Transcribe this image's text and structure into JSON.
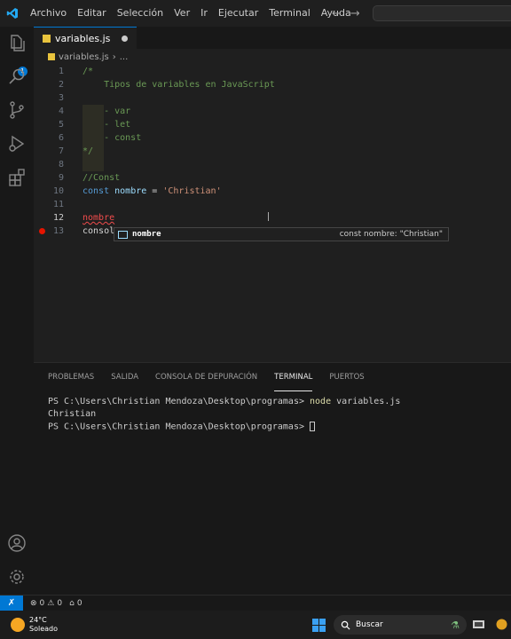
{
  "menu": [
    "Archivo",
    "Editar",
    "Selección",
    "Ver",
    "Ir",
    "Ejecutar",
    "Terminal",
    "Ayuda"
  ],
  "activity_badge": "1",
  "tab": {
    "label": "variables.js"
  },
  "breadcrumb": {
    "file": "variables.js",
    "more": "..."
  },
  "code_lines": [
    {
      "n": "1",
      "text": "/*"
    },
    {
      "n": "2",
      "text": "    Tipos de variables en JavaScript"
    },
    {
      "n": "3",
      "text": ""
    },
    {
      "n": "4",
      "text": "    - var"
    },
    {
      "n": "5",
      "text": "    - let"
    },
    {
      "n": "6",
      "text": "    - const"
    },
    {
      "n": "7",
      "text": "*/"
    },
    {
      "n": "8",
      "text": ""
    },
    {
      "n": "9",
      "text": "//Const"
    },
    {
      "n": "10",
      "kw": "const",
      "var": "nombre",
      "op": "=",
      "str": "'Christian'"
    },
    {
      "n": "11",
      "text": ""
    },
    {
      "n": "12",
      "err": "nombre"
    },
    {
      "n": "13",
      "text": "consol"
    }
  ],
  "suggest": {
    "icon": "[@]",
    "label": "nombre",
    "detail": "const nombre: \"Christian\""
  },
  "panel_tabs": [
    "PROBLEMAS",
    "SALIDA",
    "CONSOLA DE DEPURACIÓN",
    "TERMINAL",
    "PUERTOS"
  ],
  "terminal": {
    "prompt": "PS C:\\Users\\Christian Mendoza\\Desktop\\programas>",
    "cmd": "node",
    "arg": " variables.js",
    "output": "Christian",
    "prompt2": "PS C:\\Users\\Christian Mendoza\\Desktop\\programas>"
  },
  "status": {
    "errors": "0",
    "warnings": "0",
    "ports": "0"
  },
  "taskbar": {
    "temp": "24°C",
    "condition": "Soleado",
    "search": "Buscar"
  },
  "colors": {
    "accent": "#0078d4",
    "js": "#e8c33d",
    "breakpoint": "#e51400"
  }
}
